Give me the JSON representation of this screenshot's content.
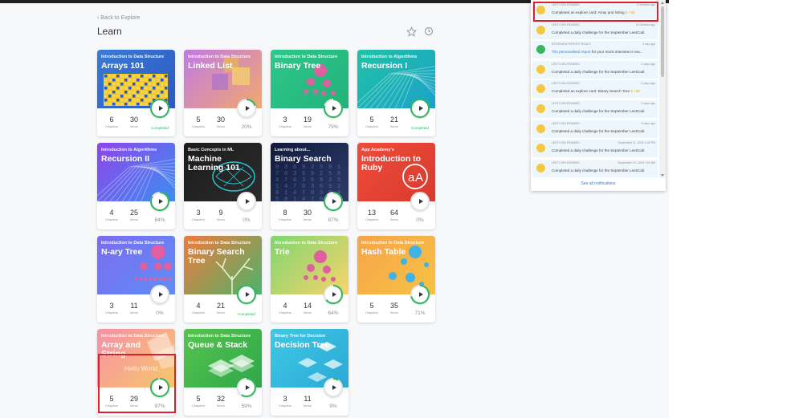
{
  "nav": {
    "back_label": "Back to Explore",
    "back_chevron": "‹"
  },
  "page": {
    "title": "Learn"
  },
  "icons": {
    "favorite": "star-icon",
    "history": "clock-icon"
  },
  "colors": {
    "accent_green": "#2db55d",
    "highlight_red": "#e01e2b",
    "link_blue": "#2c7be5"
  },
  "labels": {
    "chapters": "Chapters",
    "items": "Items"
  },
  "cards": [
    {
      "category": "Introduction to Data Structure",
      "name": "Arrays 101",
      "chapters": "6",
      "items": "30",
      "progress": "Completed",
      "progress_value": 100,
      "bg": "linear-gradient(135deg,#3a7bd5,#2b59c3)",
      "deco": "fun"
    },
    {
      "category": "Introduction to Data Structure",
      "name": "Linked List",
      "chapters": "5",
      "items": "30",
      "progress": "20%",
      "progress_value": 20,
      "bg": "linear-gradient(135deg,#c179e6,#f2a96b)",
      "deco": "squares"
    },
    {
      "category": "Introduction to Data Structure",
      "name": "Binary Tree",
      "chapters": "3",
      "items": "19",
      "progress": "79%",
      "progress_value": 79,
      "bg": "linear-gradient(135deg,#2ec78a,#23b27a)",
      "deco": "tree"
    },
    {
      "category": "Introduction to Algorithms",
      "name": "Recursion I",
      "chapters": "5",
      "items": "21",
      "progress": "Completed",
      "progress_value": 100,
      "bg": "linear-gradient(135deg,#21c2a6,#1aa2c9)",
      "deco": "lines"
    },
    {
      "category": "Introduction to Algorithms",
      "name": "Recursion II",
      "chapters": "4",
      "items": "25",
      "progress": "84%",
      "progress_value": 84,
      "bg": "linear-gradient(135deg,#8e44ec,#3b8ff0)",
      "deco": "lines"
    },
    {
      "category": "Basic Concepts in ML",
      "name": "Machine Learning 101",
      "chapters": "3",
      "items": "9",
      "progress": "0%",
      "progress_value": 0,
      "bg": "linear-gradient(135deg,#1b1b1b,#2c2c2c)",
      "deco": "brain"
    },
    {
      "category": "Learning about...",
      "name": "Binary Search",
      "chapters": "8",
      "items": "30",
      "progress": "87%",
      "progress_value": 87,
      "bg": "linear-gradient(135deg,#111a3a,#2d3b6b)",
      "deco": "digits"
    },
    {
      "category": "App Academy's",
      "name": "Introduction to Ruby",
      "chapters": "13",
      "items": "64",
      "progress": "0%",
      "progress_value": 0,
      "bg": "linear-gradient(135deg,#ef4b3b,#d93a2c)",
      "deco": "aa"
    },
    {
      "category": "Introduction to Data Structure",
      "name": "N-ary Tree",
      "chapters": "3",
      "items": "11",
      "progress": "0%",
      "progress_value": 0,
      "bg": "linear-gradient(135deg,#7b6cf0,#5f8df5)",
      "deco": "dots"
    },
    {
      "category": "Introduction to Data Structure",
      "name": "Binary Search Tree",
      "chapters": "4",
      "items": "21",
      "progress": "Completed",
      "progress_value": 100,
      "bg": "linear-gradient(135deg,#f07a3c,#4db36b)",
      "deco": "branch"
    },
    {
      "category": "Introduction to Data Structure",
      "name": "Trie",
      "chapters": "4",
      "items": "14",
      "progress": "64%",
      "progress_value": 64,
      "bg": "linear-gradient(135deg,#7ed56f,#f9d46b)",
      "deco": "tree"
    },
    {
      "category": "Introduction to Data Structure",
      "name": "Hash Table",
      "chapters": "5",
      "items": "35",
      "progress": "71%",
      "progress_value": 71,
      "bg": "linear-gradient(135deg,#f7a34b,#f6c343)",
      "deco": "bubbles"
    },
    {
      "category": "Introduction to Data Structure",
      "name": "Array and String",
      "chapters": "5",
      "items": "29",
      "progress": "97%",
      "progress_value": 97,
      "bg": "linear-gradient(135deg,#f78fa7,#f7c86b)",
      "deco": "hello",
      "deco_text": "Hello World"
    },
    {
      "category": "Introduction to Data Structure",
      "name": "Queue & Stack",
      "chapters": "5",
      "items": "32",
      "progress": "59%",
      "progress_value": 59,
      "bg": "linear-gradient(135deg,#56c44e,#2fa64a)",
      "deco": "stack"
    },
    {
      "category": "Binary Tree for Decision",
      "name": "Decision Tree",
      "chapters": "3",
      "items": "11",
      "progress": "9%",
      "progress_value": 9,
      "bg": "linear-gradient(135deg,#3fc8e4,#2aa9d6)",
      "deco": "diamonds"
    }
  ],
  "notifications": {
    "see_all": "See all notifications",
    "items": [
      {
        "type": "LEETCOIN REWARD",
        "time": "4 minutes ago",
        "text": "Completed an explore card: Array and String",
        "reward": "5 +30",
        "icon": "coin-icon"
      },
      {
        "type": "LEETCOIN REWARD",
        "time": "15 minutes ago",
        "text": "Completed a daily challenge for the September LeetCodi",
        "icon": "coin-icon"
      },
      {
        "type": "INTERVIEW REPORT READY",
        "time": "4 day ago",
        "link": "The personalised report",
        "text": " for your mock interview is rea...",
        "icon": "chart-icon"
      },
      {
        "type": "LEETCOIN REWARD",
        "time": "2 days ago",
        "text": "Completed a daily challenge for the September LeetCodi",
        "icon": "coin-icon"
      },
      {
        "type": "LEETCOIN REWARD",
        "time": "2 days ago",
        "text": "Completed an explore card: Binary Search Tree",
        "reward": "5 +30",
        "icon": "coin-icon"
      },
      {
        "type": "LEETCOIN REWARD",
        "time": "2 days ago",
        "text": "Completed a daily challenge for the September LeetCodi",
        "icon": "coin-icon"
      },
      {
        "type": "LEETCOIN REWARD",
        "time": "3 days ago",
        "text": "Completed a daily challenge for the September LeetCodi",
        "icon": "coin-icon"
      },
      {
        "type": "LEETCOIN REWARD",
        "time": "September 11, 2020 1:45 PM",
        "text": "Completed a daily challenge for the September LeetCodi",
        "icon": "coin-icon"
      },
      {
        "type": "LEETCOIN REWARD",
        "time": "September 10, 2020 7:22 AM",
        "text": "Completed a daily challenge for the September LeetCodi",
        "icon": "coin-icon"
      }
    ]
  }
}
